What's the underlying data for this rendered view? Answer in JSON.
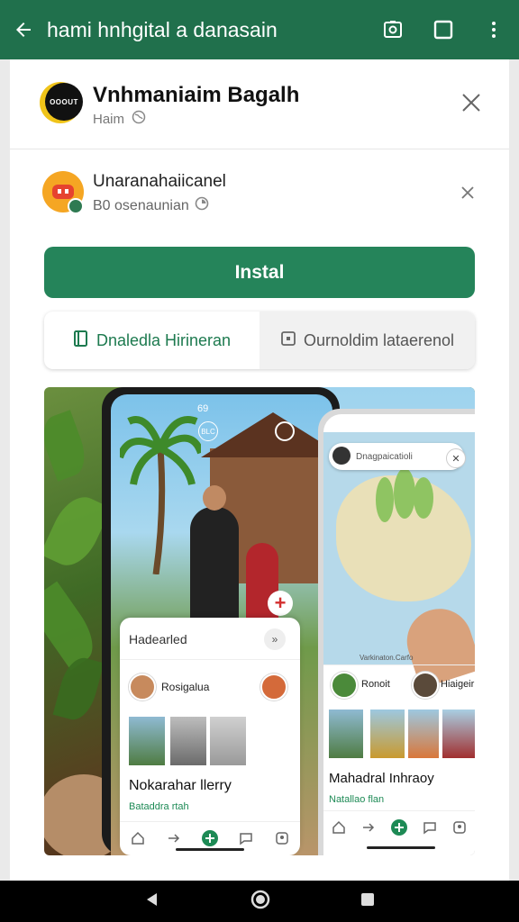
{
  "topbar": {
    "title": "hami hnhgital a danasain",
    "back_icon": "arrow-left-icon",
    "actions": [
      "camera-icon",
      "square-icon",
      "more-vert-icon"
    ],
    "bg": "#20704c"
  },
  "header_app": {
    "name": "Vnhmaniaim Bagalh",
    "subtitle": "Haim"
  },
  "promoted_app": {
    "name": "Unaranahaiicanel",
    "subtitle": "B0 osenaunian"
  },
  "install": {
    "label": "Instal",
    "color": "#25845a"
  },
  "tabs": [
    {
      "label": "Dnaledla Hirineran",
      "active": true
    },
    {
      "label": "Ournoldim lataerenol",
      "active": false
    }
  ],
  "screenshot1": {
    "status_time": "69",
    "top_badge": "BLC",
    "card_title": "Hadearled",
    "user_name": "Rosigalua",
    "post_title": "Nokarahar llerry",
    "post_link": "Bataddra rtah"
  },
  "screenshot2": {
    "search_text": "Dnagpaicatioli",
    "map_label": "Varkinaton.Carfo",
    "user_name": "Ronoit",
    "user_name2": "Hiaigeir",
    "post_title": "Mahadral Inhraoy",
    "post_link": "Natallao flan"
  },
  "system_nav": [
    "back-nav-icon",
    "home-nav-icon",
    "recents-nav-icon"
  ]
}
